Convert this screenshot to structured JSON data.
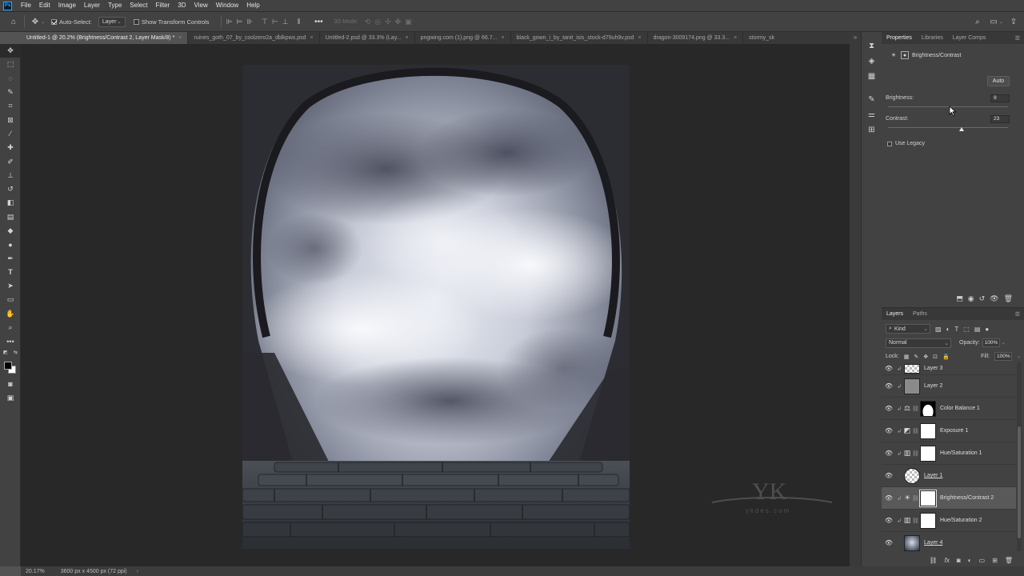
{
  "menu": [
    "File",
    "Edit",
    "Image",
    "Layer",
    "Type",
    "Select",
    "Filter",
    "3D",
    "View",
    "Window",
    "Help"
  ],
  "options_bar": {
    "auto_select_label": "Auto-Select:",
    "auto_select_target": "Layer",
    "show_transform_label": "Show Transform Controls",
    "mode_3d_label": "3D Mode:"
  },
  "doc_tabs": [
    {
      "label": "Untitled-1 @ 20.2% (Brightness/Contrast 2, Layer Mask/8) *",
      "active": true
    },
    {
      "label": "ruines_goth_07_by_coolzero2a_dblkpws.psd",
      "active": false
    },
    {
      "label": "Untitled-2.psd @ 33.3% (Lay...",
      "active": false
    },
    {
      "label": "pngwing.com (1).png @ 66.7...",
      "active": false
    },
    {
      "label": "black_gown_i_by_tanit_isis_stock-d79uh9v.psd",
      "active": false
    },
    {
      "label": "dragon-3009174.png @ 33.3...",
      "active": false
    },
    {
      "label": "stormy_sk",
      "active": false
    }
  ],
  "properties": {
    "tabs": [
      "Properties",
      "Libraries",
      "Layer Comps"
    ],
    "adjustment_title": "Brightness/Contrast",
    "auto_label": "Auto",
    "brightness_label": "Brightness:",
    "brightness_value": "9",
    "contrast_label": "Contrast:",
    "contrast_value": "23",
    "use_legacy_label": "Use Legacy"
  },
  "layers_panel": {
    "tabs": [
      "Layers",
      "Paths"
    ],
    "filter_kind": "Kind",
    "blend_mode": "Normal",
    "opacity_label": "Opacity:",
    "opacity_value": "100%",
    "lock_label": "Lock:",
    "fill_label": "Fill:",
    "fill_value": "100%",
    "layers": [
      {
        "name": "Layer 3",
        "type": "pixel",
        "clipped": true
      },
      {
        "name": "Layer 2",
        "type": "pixel",
        "clipped": true
      },
      {
        "name": "Color Balance 1",
        "type": "adjustment",
        "icon": "color-balance-icon",
        "clipped": true
      },
      {
        "name": "Exposure 1",
        "type": "adjustment",
        "icon": "exposure-icon",
        "clipped": true
      },
      {
        "name": "Hue/Saturation 1",
        "type": "adjustment",
        "icon": "hue-saturation-icon",
        "clipped": true
      },
      {
        "name": "Layer 1",
        "type": "pixel",
        "clipped": false
      },
      {
        "name": "Brightness/Contrast 2",
        "type": "adjustment",
        "icon": "brightness-contrast-icon",
        "clipped": true,
        "selected": true
      },
      {
        "name": "Hue/Saturation 2",
        "type": "adjustment",
        "icon": "hue-saturation-icon",
        "clipped": true
      },
      {
        "name": "Layer 4",
        "type": "pixel",
        "clipped": false
      }
    ]
  },
  "status_bar": {
    "zoom": "20.17%",
    "doc_info": "3600 px x 4500 px (72 ppi)"
  },
  "watermark_text": "ykdes.com",
  "colors": {
    "accent": "#31a8ff",
    "panel_bg": "#424242",
    "canvas_bg": "#282828"
  }
}
